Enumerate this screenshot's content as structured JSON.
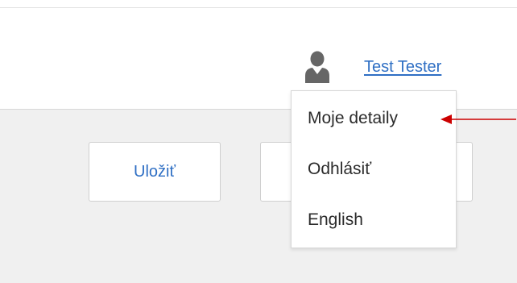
{
  "header": {
    "user_name": "Test Tester",
    "user_icon": "user-icon"
  },
  "toolbar": {
    "save_label": "Uložiť"
  },
  "user_menu": {
    "items": [
      {
        "label": "Moje detaily"
      },
      {
        "label": "Odhlásiť"
      },
      {
        "label": "English"
      }
    ]
  },
  "annotation": {
    "arrow_color": "#cc0000",
    "arrow_target": "Moje detaily"
  },
  "colors": {
    "link": "#2f6fc4",
    "content_background": "#f0f0f0"
  }
}
